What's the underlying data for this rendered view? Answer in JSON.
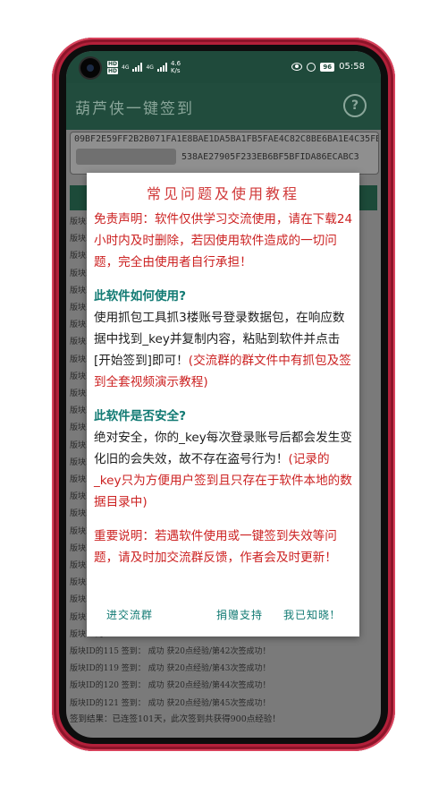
{
  "status_bar": {
    "hd1": "HD",
    "hd2": "HD",
    "net1": "4G",
    "net2": "4G",
    "speed_value": "4.6",
    "speed_unit": "K/s",
    "battery": "96",
    "time": "05:58"
  },
  "app": {
    "title": "葫芦侠一键签到",
    "help_icon": "?",
    "key_line1": "09BF2E59FF2B2B071FA1E8BAE1DA5BA1FB5FAE4C82C8BE6BA1E4C35FBF0",
    "key_line2": "538AE27905F233EB6BF5BFIDA86ECABC3"
  },
  "background_log": {
    "lines": [
      "版块ID的",
      "版块ID的",
      "版块ID的",
      "版块ID的",
      "版块ID的",
      "版块ID的",
      "版块ID的",
      "版块ID的",
      "版块ID的",
      "版块ID的",
      "版块ID的",
      "版块ID的",
      "版块ID的",
      "版块ID的",
      "版块ID的",
      "版块ID的",
      "版块ID的",
      "版块ID的",
      "版块ID的",
      "版块ID的",
      "版块ID的",
      "版块ID的",
      "版块ID的",
      "版块ID的",
      "版块ID的",
      "版块ID的115 签到： 成功  获20点经验/第42次签成功！",
      "版块ID的119 签到： 成功  获20点经验/第43次签成功！",
      "版块ID的120 签到： 成功  获20点经验/第44次签成功！",
      "版块ID的121 签到： 成功  获20点经验/第45次签成功！"
    ],
    "result": "签到结果：已连签101天，此次签到共获得900点经验！"
  },
  "dialog": {
    "title": "常见问题及使用教程",
    "disclaimer": "免责声明：软件仅供学习交流使用，请在下载24小时内及时删除，若因使用软件造成的一切问题，完全由使用者自行承担！",
    "howto_heading": "此软件如何使用?",
    "howto_body": "使用抓包工具抓3楼账号登录数据包，在响应数据中找到_key并复制内容，粘贴到软件并点击[开始签到]即可！",
    "howto_note": "(交流群的群文件中有抓包及签到全套视频演示教程)",
    "safety_heading": "此软件是否安全?",
    "safety_body": "绝对安全，你的_key每次登录账号后都会发生变化旧的会失效，故不存在盗号行为！",
    "safety_note": "(记录的_key只为方便用户签到且只存在于软件本地的数据目录中)",
    "important": "重要说明：若遇软件使用或一键签到失效等问题，请及时加交流群反馈，作者会及时更新！",
    "btn_group": "进交流群",
    "btn_donate": "捐赠支持",
    "btn_ok": "我已知晓!"
  },
  "colors": {
    "dialog_red": "#cc2222",
    "dialog_teal": "#117a73",
    "app_bar": "#214c3d",
    "phone_frame": "#b3203a"
  }
}
